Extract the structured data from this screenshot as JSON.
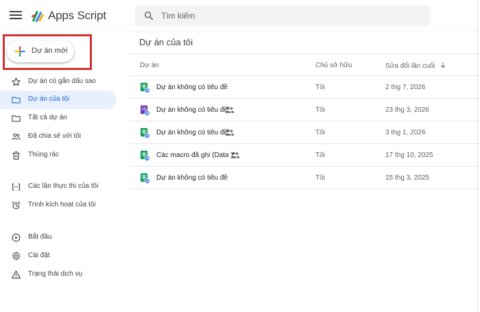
{
  "app": {
    "title": "Apps Script"
  },
  "search": {
    "placeholder": "Tìm kiếm"
  },
  "new_project": {
    "label": "Dự án mới"
  },
  "sidebar": {
    "items": [
      {
        "label": "Dự án có gắn dấu sao",
        "icon": "star-icon"
      },
      {
        "label": "Dự án của tôi",
        "icon": "folder-icon",
        "active": true
      },
      {
        "label": "Tất cả dự án",
        "icon": "folder-outline-icon"
      },
      {
        "label": "Đã chia sẻ với tôi",
        "icon": "people-icon"
      },
      {
        "label": "Thùng rác",
        "icon": "trash-icon"
      },
      {
        "label": "Các lần thực thi của tôi",
        "icon": "executions-icon"
      },
      {
        "label": "Trình kích hoạt của tôi",
        "icon": "alarm-icon"
      },
      {
        "label": "Bắt đầu",
        "icon": "play-circle-icon"
      },
      {
        "label": "Cài đặt",
        "icon": "gear-icon"
      },
      {
        "label": "Trạng thái dịch vụ",
        "icon": "warning-icon"
      }
    ]
  },
  "main": {
    "title": "Dự án của tôi",
    "columns": {
      "project": "Dự án",
      "owner": "Chủ sở hữu",
      "modified": "Sửa đổi lần cuối"
    },
    "rows": [
      {
        "name": "Dự án không có tiêu đề",
        "owner": "Tôi",
        "modified": "2 thg 7, 2026",
        "icon": "sheets-script-icon",
        "shared": false
      },
      {
        "name": "Dự án không có tiêu đề",
        "owner": "Tôi",
        "modified": "23 thg 3, 2026",
        "icon": "forms-script-icon",
        "shared": true
      },
      {
        "name": "Dự án không có tiêu đề",
        "owner": "Tôi",
        "modified": "3 thg 1, 2026",
        "icon": "sheets-script-icon",
        "shared": true
      },
      {
        "name": "Các macro đã ghi (Data )",
        "owner": "Tôi",
        "modified": "17 thg 10, 2025",
        "icon": "sheets-script-icon",
        "shared": true
      },
      {
        "name": "Dự án không có tiêu đề",
        "owner": "Tôi",
        "modified": "15 thg 3, 2025",
        "icon": "sheets-script-icon",
        "shared": false
      }
    ]
  },
  "colors": {
    "accent_blue": "#1a73e8",
    "active_bg": "#e8f0fe",
    "sheets_green": "#0f9d58",
    "forms_purple": "#673ab7",
    "highlight_red": "#d32f2f"
  }
}
